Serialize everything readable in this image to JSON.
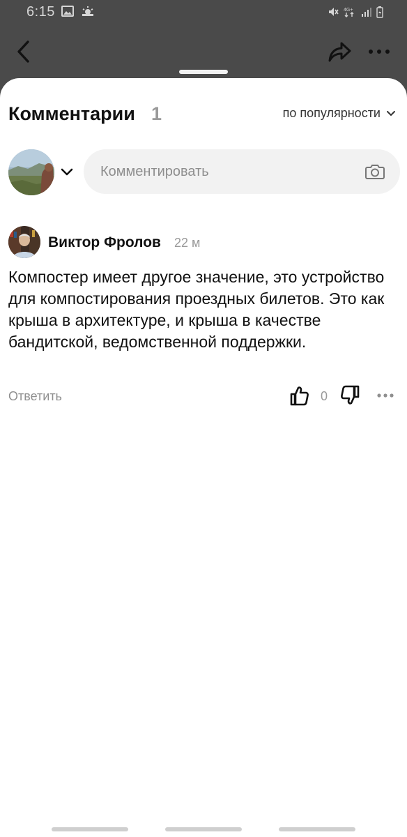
{
  "status_bar": {
    "time": "6:15"
  },
  "sheet": {
    "title": "Комментарии",
    "count": "1",
    "sort_label": "по популярности"
  },
  "composer": {
    "placeholder": "Комментировать"
  },
  "comment": {
    "author": "Виктор Фролов",
    "time": "22 м",
    "text": "Компостер имеет другое значение, это устройство для компостирования проездных билетов. Это как крыша в архитектуре, и крыша в качестве бандитской, ведомственной поддержки.",
    "reply_label": "Ответить",
    "likes": "0"
  },
  "colors": {
    "dim_overlay": "#4a4a4a",
    "sheet_bg": "#ffffff",
    "input_bg": "#f2f2f2",
    "muted_text": "#9a9a9a"
  },
  "icons": [
    "back-arrow-icon",
    "share-icon",
    "more-icon",
    "chevron-down-icon",
    "camera-icon",
    "thumbs-up-icon",
    "thumbs-down-icon"
  ]
}
